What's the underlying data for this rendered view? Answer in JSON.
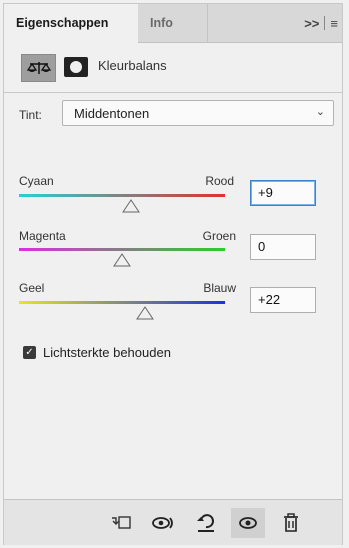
{
  "tabs": {
    "active": "Eigenschappen",
    "inactive": "Info",
    "expand_glyph": ">>",
    "menu_glyph": "≡"
  },
  "header": {
    "title": "Kleurbalans",
    "adjustment_icon": "balance-scale-icon",
    "mask_icon": "layer-mask-icon"
  },
  "tint": {
    "label": "Tint:",
    "value": "Middentonen",
    "chevron": "⌄"
  },
  "sliders": [
    {
      "left": "Cyaan",
      "right": "Rood",
      "value": "+9",
      "level": 9,
      "gradient": [
        "#22d3d3",
        "#e23030"
      ]
    },
    {
      "left": "Magenta",
      "right": "Groen",
      "value": "0",
      "level": 0,
      "gradient": [
        "#e02ce0",
        "#28d028"
      ]
    },
    {
      "left": "Geel",
      "right": "Blauw",
      "value": "+22",
      "level": 22,
      "gradient": [
        "#e6e620",
        "#2030e0"
      ]
    }
  ],
  "checkbox": {
    "label": "Lichtsterkte behouden",
    "checked": true
  },
  "toolbar": {
    "clip_icon": "clip-to-layer-icon",
    "view_previous_icon": "view-previous-state-icon",
    "reset_icon": "reset-icon",
    "visibility_icon": "visibility-eye-icon",
    "delete_icon": "trash-icon"
  }
}
